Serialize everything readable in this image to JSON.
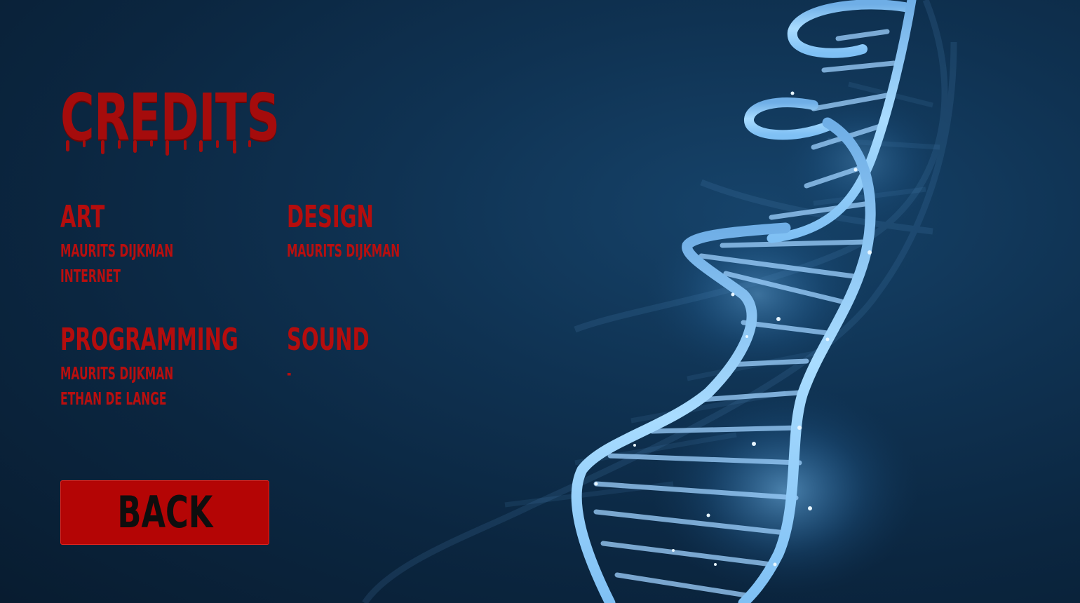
{
  "title": "CREDITS",
  "sections": {
    "art": {
      "heading": "ART",
      "names": [
        "MAURITS DIJKMAN",
        "INTERNET"
      ]
    },
    "design": {
      "heading": "DESIGN",
      "names": [
        "MAURITS DIJKMAN"
      ]
    },
    "programming": {
      "heading": "PROGRAMMING",
      "names": [
        "MAURITS DIJKMAN",
        "ETHAN DE LANGE"
      ]
    },
    "sound": {
      "heading": "SOUND",
      "names": [
        "-"
      ]
    }
  },
  "back_button": {
    "label": "BACK"
  },
  "colors": {
    "accent_red": "#b40505",
    "text_red": "#b80f0f",
    "background": "#0f3252",
    "dna_glow": "#7fc3ff"
  },
  "background_image": {
    "icon": "dna-helix-icon"
  }
}
